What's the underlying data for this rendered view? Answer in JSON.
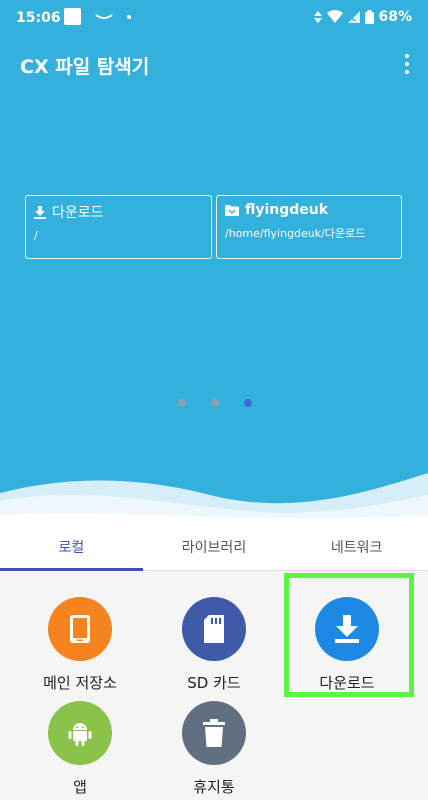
{
  "status": {
    "time": "15:06",
    "battery": "68%"
  },
  "app": {
    "title": "CX 파일 탐색기"
  },
  "cards": [
    {
      "title": "다운로드",
      "path": "/"
    },
    {
      "title": "flyingdeuk",
      "path": "/home/flyingdeuk/다운로드"
    }
  ],
  "pager": {
    "count": 3,
    "active_index": 2
  },
  "tabs": [
    {
      "label": "로컬",
      "active": true
    },
    {
      "label": "라이브러리",
      "active": false
    },
    {
      "label": "네트워크",
      "active": false
    }
  ],
  "tiles": [
    {
      "label": "메인 저장소",
      "icon": "phone-icon",
      "color": "#f5841f"
    },
    {
      "label": "SD 카드",
      "icon": "sd-card-icon",
      "color": "#3f5aa8"
    },
    {
      "label": "다운로드",
      "icon": "download-icon",
      "color": "#1e88e5"
    },
    {
      "label": "앱",
      "icon": "android-icon",
      "color": "#8bc34a"
    },
    {
      "label": "휴지통",
      "icon": "trash-icon",
      "color": "#607080"
    }
  ],
  "colors": {
    "header_bg": "#33b1dc",
    "accent": "#3f51b5",
    "highlight": "#5cf544"
  }
}
